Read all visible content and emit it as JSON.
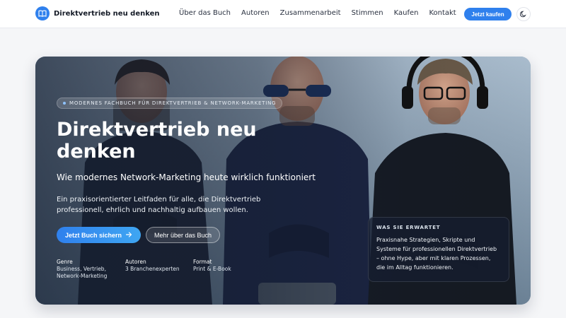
{
  "nav": {
    "brand": "Direktvertrieb neu denken",
    "items": [
      {
        "label": "Über das Buch"
      },
      {
        "label": "Autoren"
      },
      {
        "label": "Zusammenarbeit"
      },
      {
        "label": "Stimmen"
      },
      {
        "label": "Kaufen"
      },
      {
        "label": "Kontakt"
      }
    ],
    "cta": "Jetzt kaufen",
    "brand_icon": "book-icon",
    "theme_icon": "moon-icon"
  },
  "hero": {
    "badge": "MODERNES FACHBUCH FÜR DIREKTVERTRIEB & NETWORK-MARKETING",
    "title": "Direktvertrieb neu denken",
    "subtitle": "Wie modernes Network-Marketing heute wirklich funktioniert",
    "description": "Ein praxisorientierter Leitfaden für alle, die Direktvertrieb professionell, ehrlich und nachhaltig aufbauen wollen.",
    "primary_button": "Jetzt Buch sichern",
    "secondary_button": "Mehr über das Buch",
    "meta": [
      {
        "label": "Genre",
        "value": "Business, Vertrieb, Network-Marketing"
      },
      {
        "label": "Autoren",
        "value": "3 Branchenexperten"
      },
      {
        "label": "Format",
        "value": "Print & E-Book"
      }
    ],
    "expect": {
      "heading": "WAS SIE ERWARTET",
      "text": "Praxisnahe Strategien, Skripte und Systeme für professionellen Direktvertrieb – ohne Hype, aber mit klaren Prozessen, die im Alltag funktionieren."
    }
  },
  "colors": {
    "accent": "#2f80ed",
    "hero_overlay": "#141e30"
  }
}
